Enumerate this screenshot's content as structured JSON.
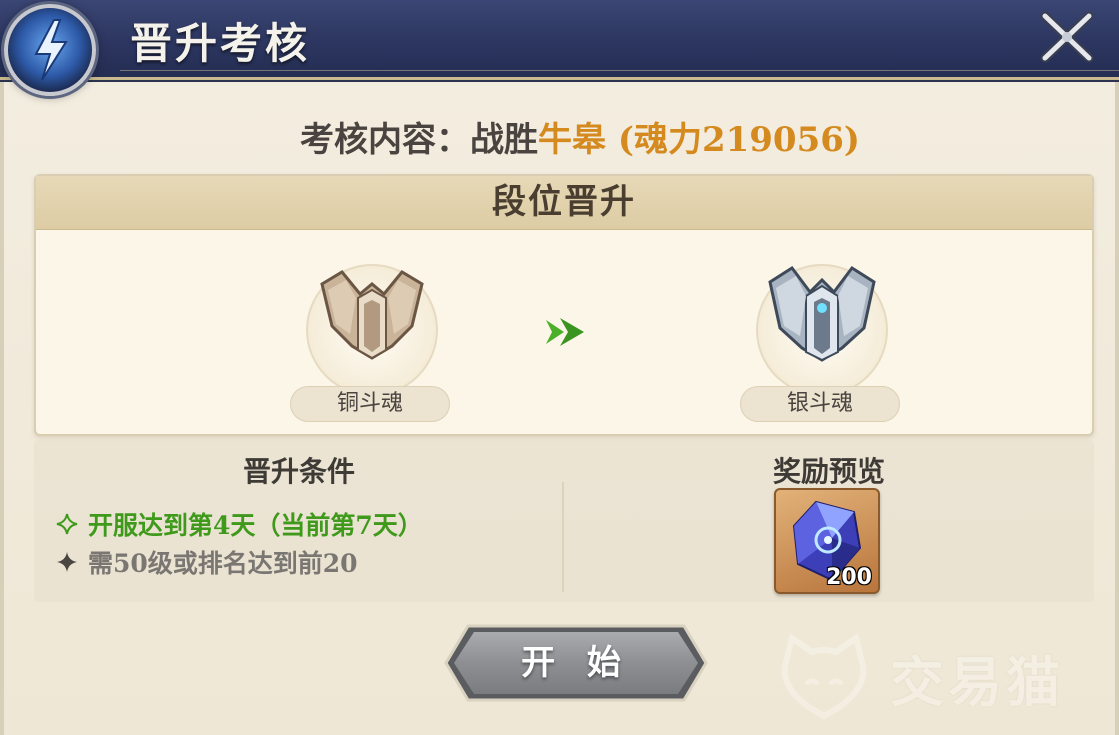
{
  "header": {
    "title": "晋升考核"
  },
  "task": {
    "prefix": "考核内容：战胜",
    "opponent": "牛皋",
    "power": "(魂力219056)"
  },
  "rank": {
    "heading": "段位晋升",
    "current": {
      "label": "铜斗魂",
      "icon": "bronze-rank-badge"
    },
    "next": {
      "label": "银斗魂",
      "icon": "silver-rank-badge"
    },
    "arrow_icon": "double-chevron-right"
  },
  "conditions": {
    "title": "晋升条件",
    "items": [
      {
        "text": "开服达到第4天（当前第7天）",
        "status": "met"
      },
      {
        "text": "需50级或排名达到前20",
        "status": "unmet"
      }
    ]
  },
  "reward": {
    "title": "奖励预览",
    "items": [
      {
        "icon": "blue-crystal",
        "count": "200"
      }
    ]
  },
  "start_button": {
    "label": "开 始"
  },
  "watermark": {
    "text": "交易猫"
  },
  "colors": {
    "header": "#2c3660",
    "highlight": "#d48a1e",
    "met": "#3f9a1c",
    "unmet": "#7a7672"
  }
}
